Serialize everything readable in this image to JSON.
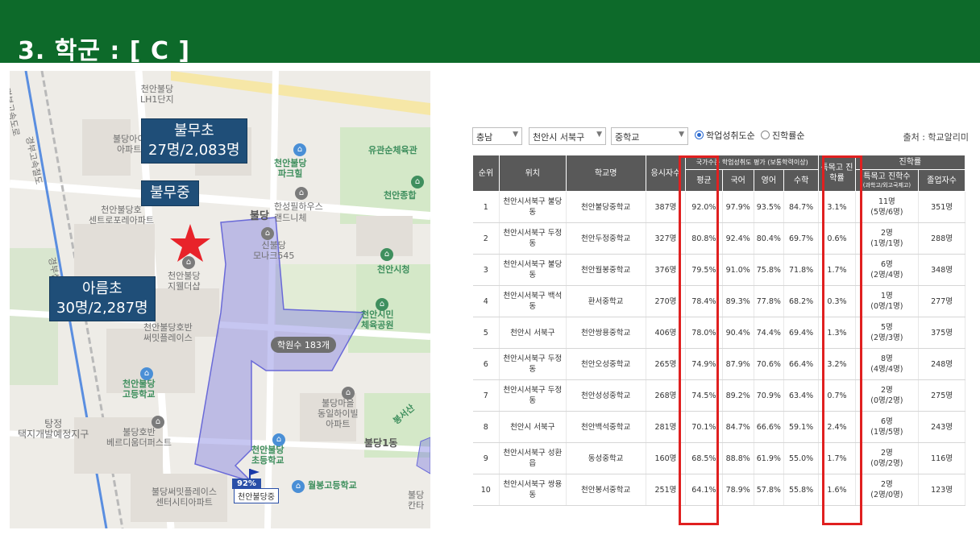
{
  "header": {
    "title": "3. 학군 : [ C ]"
  },
  "map": {
    "callouts": [
      {
        "name": "bulmu-elementary",
        "line1": "불무초",
        "line2": "27명/2,083명"
      },
      {
        "name": "bulmu-middle",
        "line1": "불무중",
        "line2": ""
      },
      {
        "name": "areum-elementary",
        "line1": "아름초",
        "line2": "30명/2,287명"
      }
    ],
    "labels": {
      "lh1": "천안불당\nLH1단지",
      "yugwansun": "유관순체육관",
      "park": "천안불당\n파크힐",
      "jonghap": "천안종합",
      "hansung": "한성필하우스",
      "buldang_dong": "불당",
      "ranto": "랜드니체",
      "central": "천안불당호\n센트로포레아파트",
      "sinbuldang": "신불당\n모나크545",
      "cityhall": "천안시청",
      "jewell": "천안불당\n지웰더샵",
      "hoban_ssum": "천안불당호반\n써밋플레이스",
      "park2": "천안시민\n체육공원",
      "highschool": "천안불당\n고등학교",
      "tangjeong": "탕정\n택지개발예정지구",
      "bellaterra": "불당호반\n베르디움더퍼스트",
      "maeul": "불당마을\n동일하이빌\n아파트",
      "elementary": "천안불당\n초등학교",
      "buldang1": "불당1동",
      "wolbong": "월봉고등학교",
      "ssum_center": "불당써밋플레이스\n센터시티아파트",
      "bongseo": "봉서산",
      "buldang2": "불당\n칸타",
      "apt_top": "불당아이\n아파트",
      "expressway1": "경부고속도로",
      "expressway2": "경부고속철도",
      "gyeongbu": "경부선"
    },
    "academy": "학원수 183개",
    "pct": "92%",
    "school_badge": "천안불당중"
  },
  "filters": {
    "region": "충남",
    "district": "천안시 서북구",
    "level": "중학교",
    "radio1": "학업성취도순",
    "radio2": "진학률순",
    "source": "출처 : 학교알리미"
  },
  "table": {
    "headers": {
      "rank": "순위",
      "location": "위치",
      "school": "학교명",
      "applicants": "응시자수",
      "group_achievement": "국가수준 학업성취도 평가 (보통학력이상)",
      "average": "평균",
      "korean": "국어",
      "english": "영어",
      "math": "수학",
      "special": "특목고 진학률",
      "group_advance": "진학률",
      "special_count": "특목고 진학수",
      "special_count_sub": "(과학고/외고국제고)",
      "graduates": "졸업자수"
    },
    "rows": [
      {
        "rank": "1",
        "location": "천안시서북구 불당동",
        "school": "천안불당중학교",
        "applicants": "387명",
        "average": "92.0%",
        "korean": "97.9%",
        "english": "93.5%",
        "math": "84.7%",
        "special": "3.1%",
        "count": "11명",
        "count_sub": "(5명/6명)",
        "graduates": "351명"
      },
      {
        "rank": "2",
        "location": "천안시서북구 두정동",
        "school": "천안두정중학교",
        "applicants": "327명",
        "average": "80.8%",
        "korean": "92.4%",
        "english": "80.4%",
        "math": "69.7%",
        "special": "0.6%",
        "count": "2명",
        "count_sub": "(1명/1명)",
        "graduates": "288명"
      },
      {
        "rank": "3",
        "location": "천안시서북구 불당동",
        "school": "천안월봉중학교",
        "applicants": "376명",
        "average": "79.5%",
        "korean": "91.0%",
        "english": "75.8%",
        "math": "71.8%",
        "special": "1.7%",
        "count": "6명",
        "count_sub": "(2명/4명)",
        "graduates": "348명"
      },
      {
        "rank": "4",
        "location": "천안시서북구 백석동",
        "school": "환서중학교",
        "applicants": "270명",
        "average": "78.4%",
        "korean": "89.3%",
        "english": "77.8%",
        "math": "68.2%",
        "special": "0.3%",
        "count": "1명",
        "count_sub": "(0명/1명)",
        "graduates": "277명"
      },
      {
        "rank": "5",
        "location": "천안시 서북구",
        "school": "천안쌍용중학교",
        "applicants": "406명",
        "average": "78.0%",
        "korean": "90.4%",
        "english": "74.4%",
        "math": "69.4%",
        "special": "1.3%",
        "count": "5명",
        "count_sub": "(2명/3명)",
        "graduates": "375명"
      },
      {
        "rank": "6",
        "location": "천안시서북구 두정동",
        "school": "천안오성중학교",
        "applicants": "265명",
        "average": "74.9%",
        "korean": "87.9%",
        "english": "70.6%",
        "math": "66.4%",
        "special": "3.2%",
        "count": "8명",
        "count_sub": "(4명/4명)",
        "graduates": "248명"
      },
      {
        "rank": "7",
        "location": "천안시서북구 두정동",
        "school": "천안성성중학교",
        "applicants": "268명",
        "average": "74.5%",
        "korean": "89.2%",
        "english": "70.9%",
        "math": "63.4%",
        "special": "0.7%",
        "count": "2명",
        "count_sub": "(0명/2명)",
        "graduates": "275명"
      },
      {
        "rank": "8",
        "location": "천안시 서북구",
        "school": "천안백석중학교",
        "applicants": "281명",
        "average": "70.1%",
        "korean": "84.7%",
        "english": "66.6%",
        "math": "59.1%",
        "special": "2.4%",
        "count": "6명",
        "count_sub": "(1명/5명)",
        "graduates": "243명"
      },
      {
        "rank": "9",
        "location": "천안시서북구 성환읍",
        "school": "동성중학교",
        "applicants": "160명",
        "average": "68.5%",
        "korean": "88.8%",
        "english": "61.9%",
        "math": "55.0%",
        "special": "1.7%",
        "count": "2명",
        "count_sub": "(0명/2명)",
        "graduates": "116명"
      },
      {
        "rank": "10",
        "location": "천안시서북구 쌍용동",
        "school": "천안봉서중학교",
        "applicants": "251명",
        "average": "64.1%",
        "korean": "78.9%",
        "english": "57.8%",
        "math": "55.8%",
        "special": "1.6%",
        "count": "2명",
        "count_sub": "(2명/0명)",
        "graduates": "123명"
      }
    ]
  },
  "colors": {
    "header_green": "#0d6a2a",
    "callout_blue": "#1f4e78",
    "highlight_red": "#e02020",
    "zone_purple": "#8080e0"
  }
}
